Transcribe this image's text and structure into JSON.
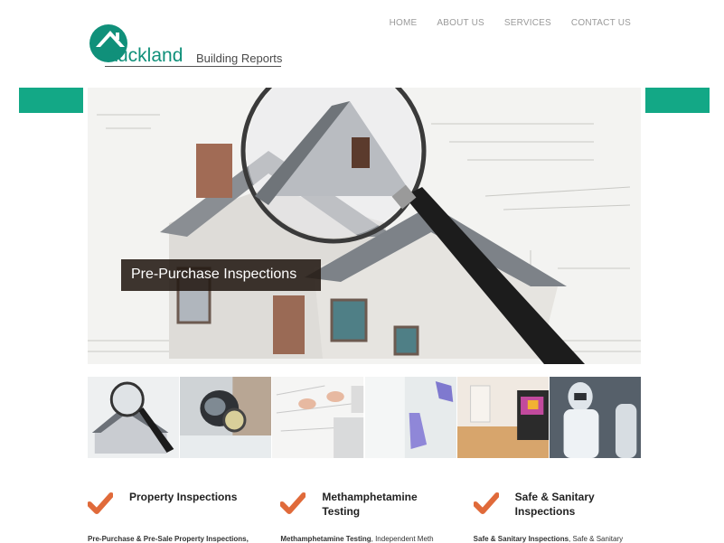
{
  "brand": {
    "logo_main": "Auckland",
    "logo_sub": "Building Reports",
    "accent": "#13a886",
    "orange": "#e06a3a"
  },
  "nav": {
    "items": [
      "HOME",
      "ABOUT US",
      "SERVICES",
      "CONTACT US"
    ]
  },
  "hero": {
    "caption": "Pre-Purchase Inspections"
  },
  "thumbnails": [
    {
      "icon": "house-magnifier-thumb"
    },
    {
      "icon": "gas-mask-thumb"
    },
    {
      "icon": "blueprints-thumb"
    },
    {
      "icon": "gloved-hand-thumb"
    },
    {
      "icon": "thermal-camera-thumb"
    },
    {
      "icon": "hazmat-suit-thumb"
    }
  ],
  "services": [
    {
      "title": "Property Inspections",
      "text_bold": "Pre-Purchase & Pre-Sale Property Inspections,",
      "text_rest": ""
    },
    {
      "title": "Methamphetamine Testing",
      "text_bold": "Methamphetamine Testing",
      "text_rest": ", Independent Meth"
    },
    {
      "title": "Safe & Sanitary Inspections",
      "text_bold": "Safe & Sanitary Inspections",
      "text_rest": ", Safe & Sanitary"
    }
  ]
}
